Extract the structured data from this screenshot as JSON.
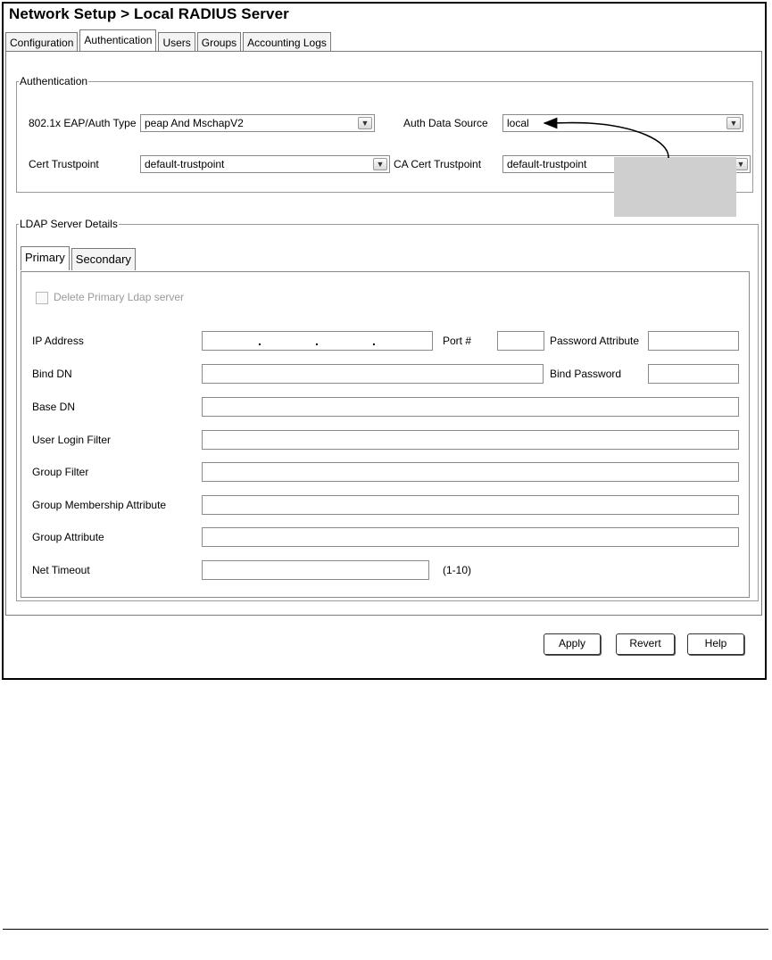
{
  "window": {
    "title": "Network Setup > Local RADIUS Server"
  },
  "tabs": [
    {
      "label": "Configuration"
    },
    {
      "label": "Authentication"
    },
    {
      "label": "Users"
    },
    {
      "label": "Groups"
    },
    {
      "label": "Accounting Logs"
    }
  ],
  "active_tab": "Authentication",
  "auth": {
    "legend": "Authentication",
    "eap_label": "802.1x EAP/Auth Type",
    "eap_value": "peap And MschapV2",
    "source_label": "Auth Data Source",
    "source_value": "local",
    "cert_label": "Cert Trustpoint",
    "cert_value": "default-trustpoint",
    "ca_label": "CA Cert Trustpoint",
    "ca_value": "default-trustpoint"
  },
  "ldap": {
    "legend": "LDAP Server Details",
    "subtabs": [
      {
        "label": "Primary"
      },
      {
        "label": "Secondary"
      }
    ],
    "delete_label": "Delete Primary Ldap server",
    "ip_label": "IP Address",
    "port_label": "Port #",
    "password_attr_label": "Password Attribute",
    "bind_dn_label": "Bind DN",
    "bind_password_label": "Bind Password",
    "base_dn_label": "Base DN",
    "user_filter_label": "User Login Filter",
    "group_filter_label": "Group Filter",
    "group_membership_label": "Group Membership Attribute",
    "group_attr_label": "Group Attribute",
    "net_timeout_label": "Net Timeout",
    "net_timeout_range": "(1-10)"
  },
  "buttons": {
    "apply": "Apply",
    "revert": "Revert",
    "help": "Help"
  }
}
